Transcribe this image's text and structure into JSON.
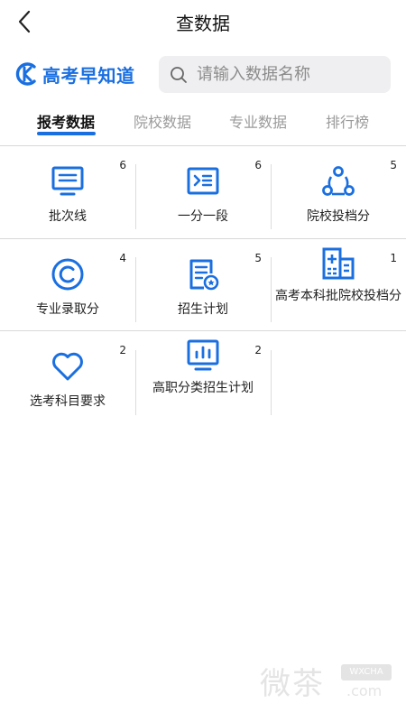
{
  "header": {
    "title": "查数据",
    "back_icon": "chevron-left-icon"
  },
  "brand": {
    "name": "高考早知道",
    "accent": "#1a6fe0"
  },
  "search": {
    "placeholder": "请输入数据名称",
    "value": ""
  },
  "tabs": [
    {
      "label": "报考数据",
      "active": true
    },
    {
      "label": "院校数据",
      "active": false
    },
    {
      "label": "专业数据",
      "active": false
    },
    {
      "label": "排行榜",
      "active": false
    }
  ],
  "grid": [
    {
      "label": "批次线",
      "count": "6",
      "icon": "monitor-icon"
    },
    {
      "label": "一分一段",
      "count": "6",
      "icon": "terminal-icon"
    },
    {
      "label": "院校投档分",
      "count": "5",
      "icon": "share-nodes-icon"
    },
    {
      "label": "专业录取分",
      "count": "4",
      "icon": "copyright-icon"
    },
    {
      "label": "招生计划",
      "count": "5",
      "icon": "document-badge-icon"
    },
    {
      "label": "高考本科批院校投档分",
      "count": "1",
      "icon": "hospital-building-icon"
    },
    {
      "label": "选考科目要求",
      "count": "2",
      "icon": "heart-icon"
    },
    {
      "label": "高职分类招生计划",
      "count": "2",
      "icon": "chart-monitor-icon"
    }
  ],
  "watermark": {
    "chars": "微茶",
    "badge": "WXCHA",
    "domain": ".com"
  }
}
